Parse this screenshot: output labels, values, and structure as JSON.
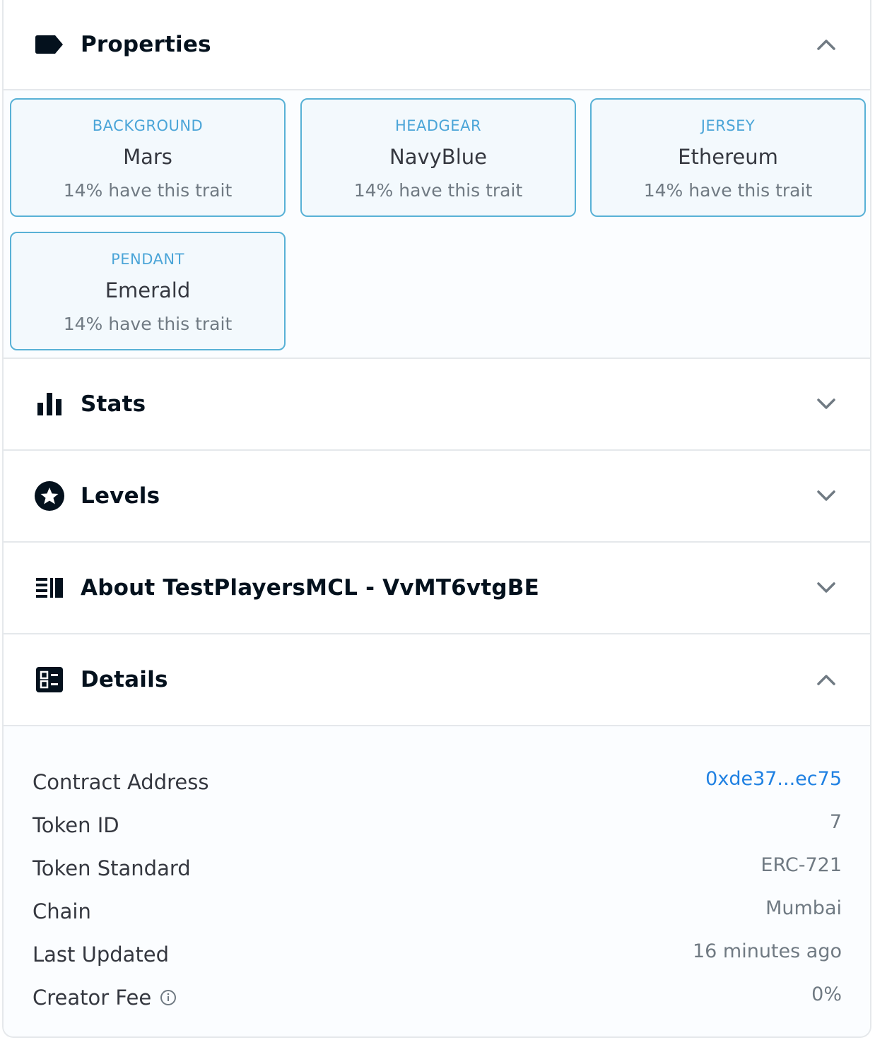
{
  "sections": {
    "properties": {
      "title": "Properties",
      "icon": "label-icon",
      "state": "expanded"
    },
    "stats": {
      "title": "Stats",
      "icon": "bar-chart-icon",
      "state": "collapsed"
    },
    "levels": {
      "title": "Levels",
      "icon": "star-circle-icon",
      "state": "collapsed"
    },
    "about": {
      "title": "About TestPlayersMCL - VvMT6vtgBE",
      "icon": "description-icon",
      "state": "collapsed"
    },
    "details": {
      "title": "Details",
      "icon": "details-list-icon",
      "state": "expanded"
    }
  },
  "traits": [
    {
      "type": "BACKGROUND",
      "value": "Mars",
      "rarity": "14% have this trait"
    },
    {
      "type": "HEADGEAR",
      "value": "NavyBlue",
      "rarity": "14% have this trait"
    },
    {
      "type": "JERSEY",
      "value": "Ethereum",
      "rarity": "14% have this trait"
    },
    {
      "type": "PENDANT",
      "value": "Emerald",
      "rarity": "14% have this trait"
    }
  ],
  "details": {
    "contract_address": {
      "label": "Contract Address",
      "value": "0xde37...ec75"
    },
    "token_id": {
      "label": "Token ID",
      "value": "7"
    },
    "token_standard": {
      "label": "Token Standard",
      "value": "ERC-721"
    },
    "chain": {
      "label": "Chain",
      "value": "Mumbai"
    },
    "last_updated": {
      "label": "Last Updated",
      "value": "16 minutes ago"
    },
    "creator_fee": {
      "label": "Creator Fee",
      "value": "0%",
      "info_icon": "info-icon"
    }
  },
  "colors": {
    "accent_link": "#2081e2",
    "trait_border": "#58b1d6",
    "trait_type": "#4ba5d8",
    "divider": "#e5e8eb"
  }
}
